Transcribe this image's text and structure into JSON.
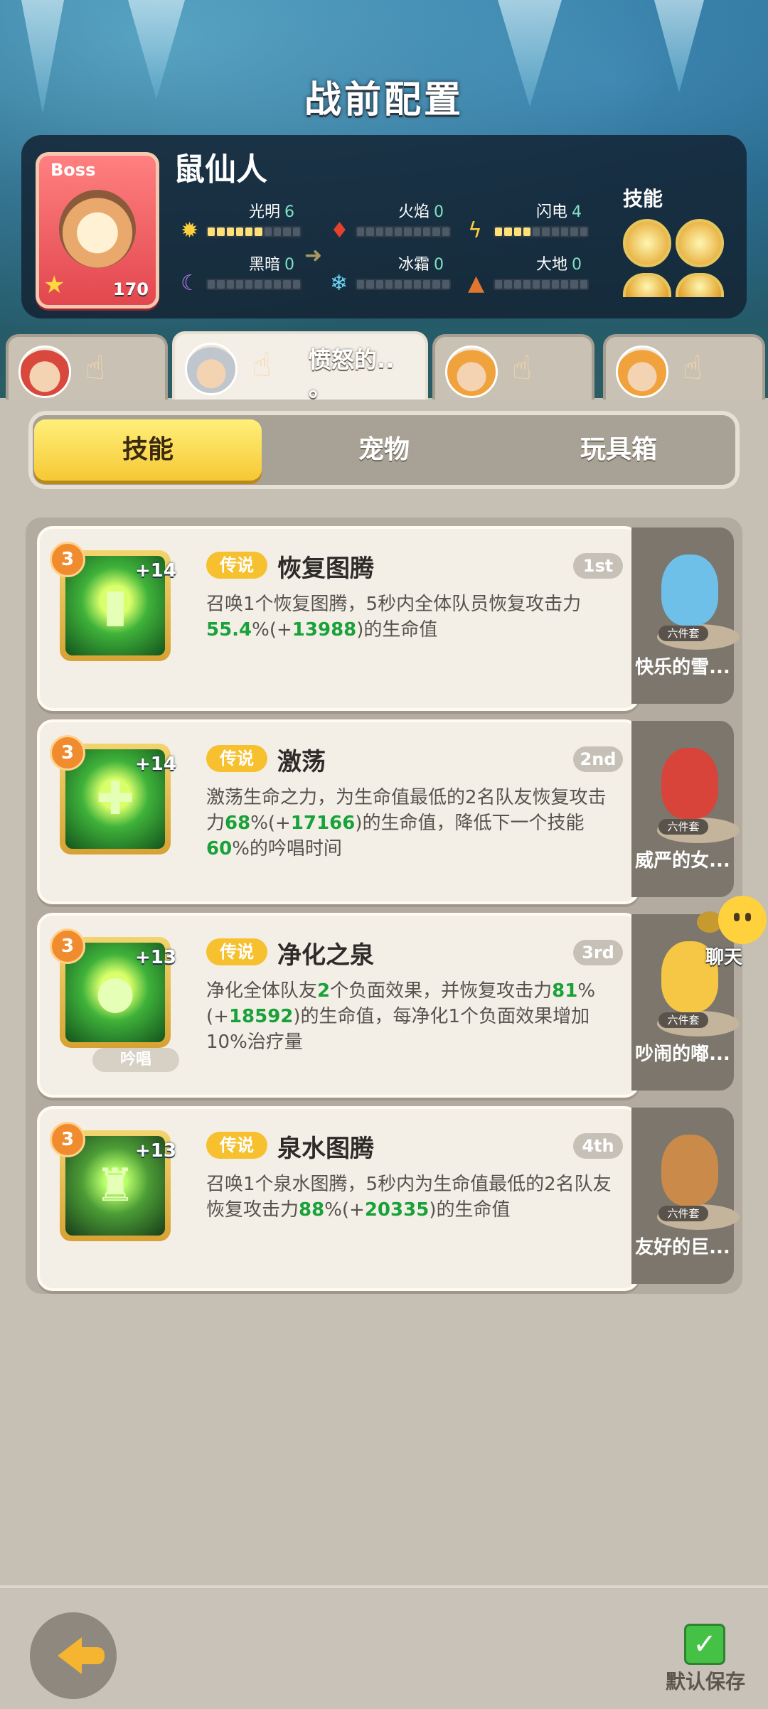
{
  "header": {
    "title": "战前配置"
  },
  "boss": {
    "tag": "Boss",
    "name": "鼠仙人",
    "level": "170",
    "skills_label": "技能",
    "elements": [
      {
        "key": "light",
        "label": "光明",
        "value": "6",
        "icon": "sun-icon",
        "fill": 6
      },
      {
        "key": "fire",
        "label": "火焰",
        "value": "0",
        "icon": "flame-icon",
        "fill": 0
      },
      {
        "key": "electric",
        "label": "闪电",
        "value": "4",
        "icon": "lightning-icon",
        "fill": 4
      },
      {
        "key": "dark",
        "label": "黑暗",
        "value": "0",
        "icon": "moon-icon",
        "fill": 0
      },
      {
        "key": "ice",
        "label": "冰霜",
        "value": "0",
        "icon": "snowflake-icon",
        "fill": 0
      },
      {
        "key": "earth",
        "label": "大地",
        "value": "0",
        "icon": "mountain-icon",
        "fill": 0
      }
    ]
  },
  "hero_tabs": [
    {
      "name": "",
      "avatar": "red-hair"
    },
    {
      "name": "愤怒的..",
      "name2": "。",
      "avatar": "grey-hair",
      "active": true
    },
    {
      "name": "",
      "avatar": "orange-hair"
    },
    {
      "name": "",
      "avatar": "orange-hair"
    }
  ],
  "category_tabs": [
    "技能",
    "宠物",
    "玩具箱"
  ],
  "skills": [
    {
      "rank": "3",
      "plus": "+14",
      "badge": "传说",
      "name": "恢复图腾",
      "order": "1st",
      "desc_pre": "召唤1个恢复图腾，5秒内全体队员恢复攻击力",
      "desc_hl1": "55.4",
      "desc_mid": "%(+",
      "desc_hl2": "13988",
      "desc_post": ")的生命值",
      "chant": ""
    },
    {
      "rank": "3",
      "plus": "+14",
      "badge": "传说",
      "name": "激荡",
      "order": "2nd",
      "desc_pre": "激荡生命之力，为生命值最低的2名队友恢复攻击力",
      "desc_hl1": "68",
      "desc_mid": "%(+",
      "desc_hl2": "17166",
      "desc_post": ")的生命值，降低下一个技能",
      "desc_hl3": "60",
      "desc_post2": "%的吟唱时间",
      "chant": ""
    },
    {
      "rank": "3",
      "plus": "+13",
      "badge": "传说",
      "name": "净化之泉",
      "order": "3rd",
      "desc_pre": "净化全体队友",
      "desc_hl1": "2",
      "desc_mid": "个负面效果，并恢复攻击力",
      "desc_hl2": "81",
      "desc_mid2": "%(+",
      "desc_hl3": "18592",
      "desc_post": ")的生命值，每净化1个负面效果增加10%治疗量",
      "chant": "吟唱"
    },
    {
      "rank": "3",
      "plus": "+13",
      "badge": "传说",
      "name": "泉水图腾",
      "order": "4th",
      "desc_pre": "召唤1个泉水图腾，5秒内为生命值最低的2名队友恢复攻击力",
      "desc_hl1": "88",
      "desc_mid": "%(+",
      "desc_hl2": "20335",
      "desc_post": ")的生命值",
      "chant": ""
    }
  ],
  "pets": [
    {
      "name": "快乐的雪...",
      "set": "六件套",
      "color": "#6fc0e8"
    },
    {
      "name": "威严的女...",
      "set": "六件套",
      "color": "#d8433a"
    },
    {
      "name": "吵闹的嘟...",
      "set": "六件套",
      "color": "#f5c744"
    },
    {
      "name": "友好的巨...",
      "set": "六件套",
      "color": "#c98a4a"
    }
  ],
  "chat": {
    "label": "聊天"
  },
  "footer": {
    "save_label": "默认保存"
  }
}
